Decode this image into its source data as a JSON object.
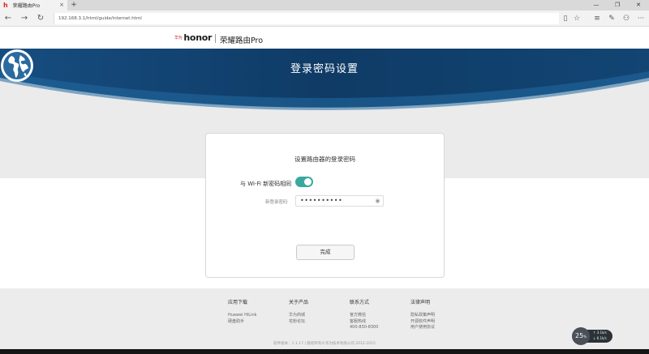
{
  "browser": {
    "tab_title": "荣耀路由Pro",
    "tab_close": "×",
    "new_tab": "+",
    "url": "192.168.3.1/html/guide/internet.html"
  },
  "brand": {
    "logo_text": "honor",
    "logo_prefix": "华为",
    "product_name": "荣耀路由Pro"
  },
  "hero": {
    "title": "登录密码设置",
    "colors": {
      "dark": "#0f3b66",
      "mid": "#1c5d92",
      "light": "#ebebeb"
    }
  },
  "card": {
    "title": "设置路由器的登录密码",
    "wifi_same_label": "与 Wi-Fi 新密码相同",
    "wifi_same_toggle": "on",
    "password_label": "新登录密码",
    "password_value": "••••••••••",
    "done_button": "完成",
    "accent_color": "#3ba8a0"
  },
  "footer": {
    "columns": [
      {
        "heading": "应用下载",
        "items": [
          "Huawei HiLink",
          "硬盘助手"
        ]
      },
      {
        "heading": "关于产品",
        "items": [
          "华为商城",
          "花粉论坛"
        ]
      },
      {
        "heading": "联系方式",
        "items": [
          "官方微信",
          "客服热线",
          "400-830-8300"
        ]
      },
      {
        "heading": "法律声明",
        "items": [
          "隐私政策声明",
          "开源软件声明",
          "用户使用协议"
        ]
      }
    ],
    "copyright": "软件版本：1.1.17  |  版权所有©华为技术有限公司 2012-2015"
  },
  "widget": {
    "percent": "25",
    "unit": "%",
    "up": "3.1k/s",
    "down": "6.1k/s"
  }
}
